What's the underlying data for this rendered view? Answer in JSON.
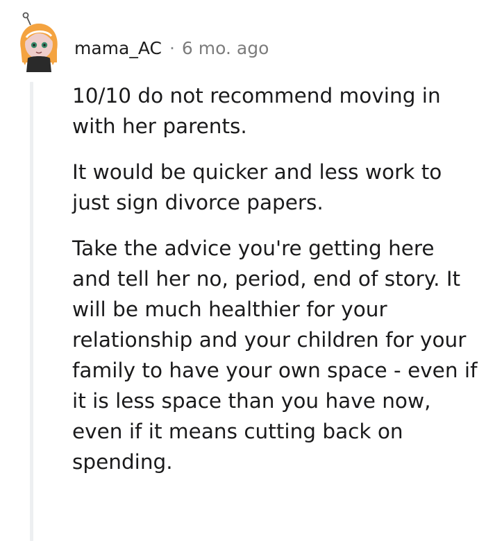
{
  "comment": {
    "author": "mama_AC",
    "separator": "·",
    "timestamp": "6 mo. ago",
    "paragraphs": [
      "10/10 do not recommend moving in with her parents.",
      "It would be quicker and less work to just sign divorce papers.",
      "Take the advice you're getting here and tell her no, period, end of story. It will be much healthier for your relationship and your children for your family to have your own space - even if it is less space than you have now, even if it means cutting back on spending."
    ]
  },
  "avatar": {
    "icon": "snoo-avatar-icon",
    "hair_color": "#f4a340",
    "skin_color": "#eecdca",
    "shirt_color": "#2a2a2a"
  },
  "colors": {
    "thread_line": "#edeff1",
    "meta_text": "#7c7c7c",
    "body_text": "#1a1a1b"
  }
}
